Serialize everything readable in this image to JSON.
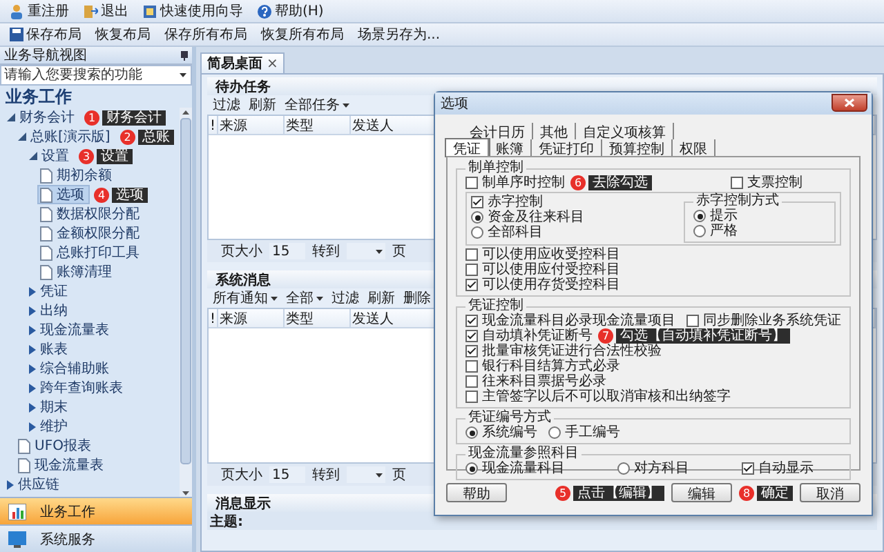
{
  "toolbar_1": [
    {
      "label": "重注册",
      "kind": "user"
    },
    {
      "label": "退出",
      "kind": "exit"
    },
    {
      "label": "快速使用向导",
      "kind": "wizard"
    },
    {
      "label": "帮助(H)",
      "kind": "help"
    }
  ],
  "toolbar_2": [
    {
      "label": "保存布局",
      "kind": "save"
    },
    {
      "label": "恢复布局",
      "kind": "plain"
    },
    {
      "label": "保存所有布局",
      "kind": "plain"
    },
    {
      "label": "恢复所有布局",
      "kind": "plain"
    },
    {
      "label": "场景另存为...",
      "kind": "plain"
    }
  ],
  "nav": {
    "header": "业务导航视图",
    "search_placeholder": "请输入您要搜索的功能",
    "title": "业务工作",
    "tree": [
      {
        "label": "财务会计",
        "kind": "folder",
        "expanded": true,
        "selected": false,
        "callout": {
          "number": "1",
          "text": "财务会计"
        },
        "children": [
          {
            "label": "总账[演示版]",
            "kind": "folder",
            "expanded": true,
            "selected": false,
            "callout": {
              "number": "2",
              "text": "总账"
            },
            "children": [
              {
                "label": "设置",
                "kind": "folder",
                "expanded": true,
                "selected": false,
                "callout": {
                  "number": "3",
                  "text": "设置"
                },
                "children": [
                  {
                    "label": "期初余额",
                    "kind": "doc",
                    "selected": false
                  },
                  {
                    "label": "选项",
                    "kind": "doc",
                    "selected": true,
                    "callout": {
                      "number": "4",
                      "text": "选项"
                    }
                  },
                  {
                    "label": "数据权限分配",
                    "kind": "doc",
                    "selected": false
                  },
                  {
                    "label": "金额权限分配",
                    "kind": "doc",
                    "selected": false
                  },
                  {
                    "label": "总账打印工具",
                    "kind": "doc",
                    "selected": false
                  },
                  {
                    "label": "账簿清理",
                    "kind": "doc",
                    "selected": false
                  }
                ]
              },
              {
                "label": "凭证",
                "kind": "folder",
                "expanded": false,
                "selected": false
              },
              {
                "label": "出纳",
                "kind": "folder",
                "expanded": false,
                "selected": false
              },
              {
                "label": "现金流量表",
                "kind": "folder",
                "expanded": false,
                "selected": false
              },
              {
                "label": "账表",
                "kind": "folder",
                "expanded": false,
                "selected": false
              },
              {
                "label": "综合辅助账",
                "kind": "folder",
                "expanded": false,
                "selected": false
              },
              {
                "label": "跨年查询账表",
                "kind": "folder",
                "expanded": false,
                "selected": false
              },
              {
                "label": "期末",
                "kind": "folder",
                "expanded": false,
                "selected": false
              },
              {
                "label": "维护",
                "kind": "folder",
                "expanded": false,
                "selected": false
              }
            ]
          },
          {
            "label": "UFO报表",
            "kind": "doc",
            "selected": false
          },
          {
            "label": "现金流量表",
            "kind": "doc",
            "selected": false
          }
        ]
      },
      {
        "label": "供应链",
        "kind": "folder",
        "expanded": false,
        "selected": false
      }
    ],
    "bottom_buttons": [
      {
        "label": "业务工作",
        "kind": "chart",
        "selected": true
      },
      {
        "label": "系统服务",
        "kind": "monitor",
        "selected": false
      }
    ]
  },
  "main": {
    "tab": {
      "label": "简易桌面",
      "close": "×"
    },
    "tasks": {
      "title": "待办任务",
      "actions": [
        {
          "label": "过滤",
          "dropdown": false
        },
        {
          "label": "刷新",
          "dropdown": false
        },
        {
          "label": "全部任务",
          "dropdown": true
        }
      ],
      "columns": [
        "!",
        "来源",
        "类型",
        "发送人"
      ],
      "pager": {
        "size_label": "页大小",
        "size": "15",
        "goto_label": "转到",
        "page_label": "页"
      }
    },
    "messages": {
      "title": "系统消息",
      "actions": [
        {
          "label": "所有通知",
          "dropdown": true
        },
        {
          "label": "全部",
          "dropdown": true
        },
        {
          "label": "过滤",
          "dropdown": false
        },
        {
          "label": "刷新",
          "dropdown": false
        },
        {
          "label": "删除",
          "dropdown": false
        }
      ],
      "columns": [
        "!",
        "来源",
        "类型",
        "发送人"
      ],
      "pager": {
        "size_label": "页大小",
        "size": "15",
        "goto_label": "转到",
        "page_label": "页"
      }
    },
    "message_view": {
      "title": "消息显示",
      "subject_label": "主题:"
    }
  },
  "dialog": {
    "title": "选项",
    "tabs_row_1": [
      {
        "label": "会计日历",
        "selected": false
      },
      {
        "label": "其他",
        "selected": false
      },
      {
        "label": "自定义项核算",
        "selected": false
      }
    ],
    "tabs_row_2": [
      {
        "label": "凭证",
        "selected": true
      },
      {
        "label": "账簿",
        "selected": false
      },
      {
        "label": "凭证打印",
        "selected": false
      },
      {
        "label": "预算控制",
        "selected": false
      },
      {
        "label": "权限",
        "selected": false
      }
    ],
    "voucher_making": {
      "title": "制单控制",
      "sequence_control": {
        "label": "制单序时控制",
        "checked": false,
        "callout": {
          "number": "6",
          "text": "去除勾选"
        }
      },
      "check_control": {
        "label": "支票控制",
        "checked": false
      },
      "deficit_control": {
        "label": "赤字控制",
        "checked": true
      },
      "deficit_scope": [
        {
          "label": "资金及往来科目",
          "selected": true
        },
        {
          "label": "全部科目",
          "selected": false
        }
      ],
      "deficit_mode": {
        "title": "赤字控制方式",
        "options": [
          {
            "label": "提示",
            "selected": true
          },
          {
            "label": "严格",
            "selected": false
          }
        ]
      },
      "controlled_accounts": [
        {
          "label": "可以使用应收受控科目",
          "checked": false
        },
        {
          "label": "可以使用应付受控科目",
          "checked": false
        },
        {
          "label": "可以使用存货受控科目",
          "checked": true
        }
      ]
    },
    "voucher_control": {
      "title": "凭证控制",
      "options": [
        {
          "label": "现金流量科目必录现金流量项目",
          "checked": true
        },
        {
          "label": "同步删除业务系统凭证",
          "checked": false
        },
        {
          "label": "自动填补凭证断号",
          "checked": true,
          "callout": {
            "number": "7",
            "text": "勾选【自动填补凭证断号】"
          }
        },
        {
          "label": "批量审核凭证进行合法性校验",
          "checked": true
        },
        {
          "label": "银行科目结算方式必录",
          "checked": false
        },
        {
          "label": "往来科目票据号必录",
          "checked": false
        },
        {
          "label": "主管签字以后不可以取消审核和出纳签字",
          "checked": false
        }
      ]
    },
    "numbering": {
      "title": "凭证编号方式",
      "options": [
        {
          "label": "系统编号",
          "selected": true
        },
        {
          "label": "手工编号",
          "selected": false
        }
      ]
    },
    "cash_flow_reference": {
      "title": "现金流量参照科目",
      "options": [
        {
          "label": "现金流量科目",
          "selected": true
        },
        {
          "label": "对方科目",
          "selected": false
        }
      ],
      "auto_display": {
        "label": "自动显示",
        "checked": true
      }
    },
    "footer": [
      {
        "kind": "button",
        "label": "帮助"
      },
      {
        "kind": "callout",
        "number": "5",
        "text": "点击【编辑】"
      },
      {
        "kind": "button",
        "label": "编辑"
      },
      {
        "kind": "callout",
        "number": "8",
        "text": "确定"
      },
      {
        "kind": "button",
        "label": "取消"
      }
    ]
  }
}
